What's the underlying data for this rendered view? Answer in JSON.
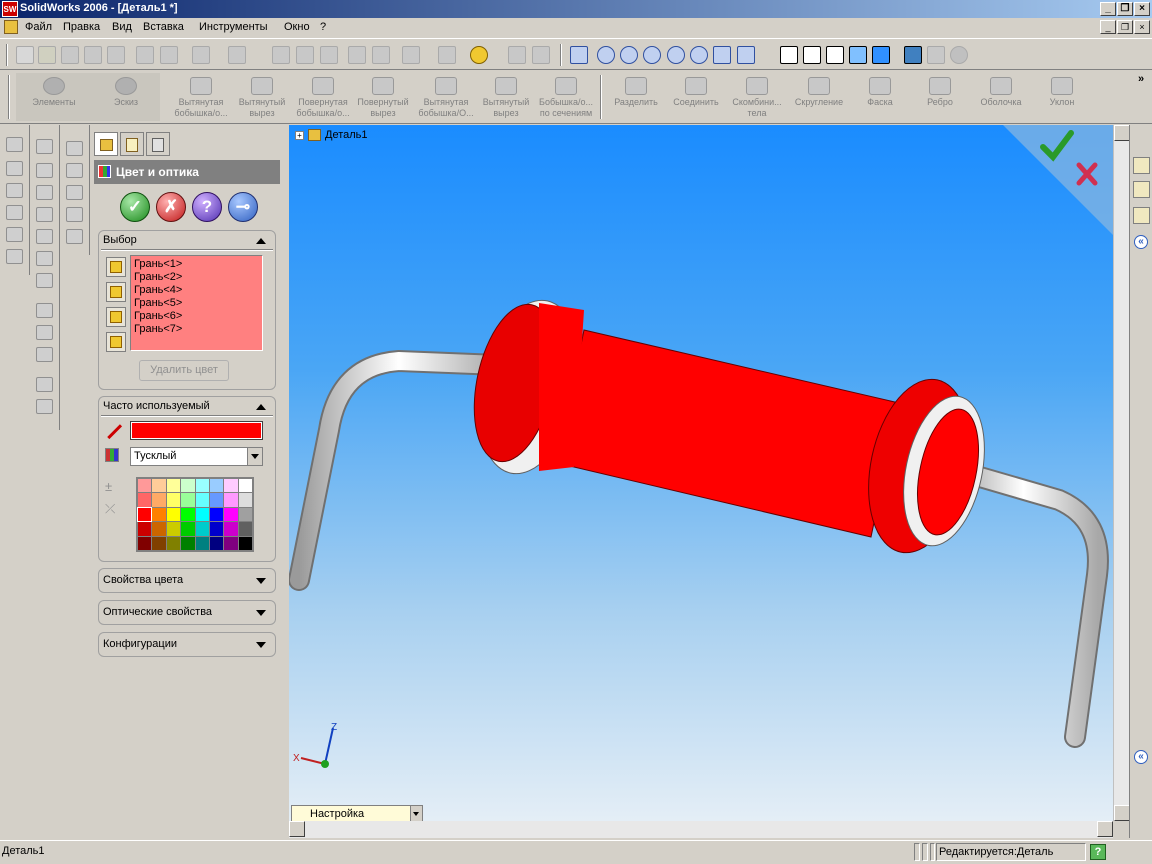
{
  "window": {
    "title": "SolidWorks 2006 - [Деталь1 *]",
    "logo_text": "SW"
  },
  "menu": {
    "items": [
      "Файл",
      "Правка",
      "Вид",
      "Вставка",
      "Инструменты",
      "Окно",
      "?"
    ]
  },
  "command_manager": {
    "items": [
      {
        "label": "Элементы",
        "icon": "features-icon"
      },
      {
        "label": "Эскиз",
        "icon": "sketch-icon"
      },
      {
        "label": "Вытянутая бобышка/о...",
        "icon": "extruded-boss-icon"
      },
      {
        "label": "Вытянутый вырез",
        "icon": "extruded-cut-icon"
      },
      {
        "label": "Повернутая бобышка/о...",
        "icon": "revolved-boss-icon"
      },
      {
        "label": "Повернутый вырез",
        "icon": "revolved-cut-icon"
      },
      {
        "label": "Вытянутая бобышка/О...",
        "icon": "swept-boss-icon"
      },
      {
        "label": "Вытянутый вырез",
        "icon": "swept-cut-icon"
      },
      {
        "label": "Бобышка/о... по сечениям",
        "icon": "lofted-boss-icon"
      },
      {
        "label": "Разделить",
        "icon": "split-icon"
      },
      {
        "label": "Соединить",
        "icon": "join-icon"
      },
      {
        "label": "Скомбини... тела",
        "icon": "combine-icon"
      },
      {
        "label": "Скругление",
        "icon": "fillet-icon"
      },
      {
        "label": "Фаска",
        "icon": "chamfer-icon"
      },
      {
        "label": "Ребро",
        "icon": "rib-icon"
      },
      {
        "label": "Оболочка",
        "icon": "shell-icon"
      },
      {
        "label": "Уклон",
        "icon": "draft-icon"
      }
    ],
    "more": "»"
  },
  "property_manager": {
    "title": "Цвет и оптика",
    "ok": "✓",
    "cancel": "✗",
    "help": "?",
    "pin": "⊸",
    "selection": {
      "title": "Выбор",
      "faces": [
        "Грань<1>",
        "Грань<2>",
        "Грань<4>",
        "Грань<5>",
        "Грань<6>",
        "Грань<7>"
      ],
      "remove_button": "Удалить цвет",
      "list_color": "#ff8080"
    },
    "favorite": {
      "title": "Часто используемый",
      "current_color": "#ff0000",
      "finish": "Тусклый",
      "palette": [
        "#ff9999",
        "#ffcc99",
        "#ffff99",
        "#ccffcc",
        "#99ffff",
        "#99ccff",
        "#ffccff",
        "#ffffff",
        "#ff6666",
        "#ffaa66",
        "#ffff66",
        "#99ff99",
        "#66ffff",
        "#6699ff",
        "#ff99ff",
        "#dddddd",
        "#ff0000",
        "#ff8000",
        "#ffff00",
        "#00ff00",
        "#00ffff",
        "#0000ff",
        "#ff00ff",
        "#a0a0a0",
        "#cc0000",
        "#cc6600",
        "#cccc00",
        "#00cc00",
        "#00cccc",
        "#0000cc",
        "#cc00cc",
        "#606060",
        "#800000",
        "#804000",
        "#808000",
        "#008000",
        "#008080",
        "#000080",
        "#800080",
        "#000000"
      ]
    },
    "collapsed_groups": [
      "Свойства цвета",
      "Оптические свойства",
      "Конфигурации"
    ]
  },
  "viewport": {
    "tree_root": "Деталь1",
    "config_tab": "Настройка",
    "axes": {
      "x": "X",
      "z": "Z"
    },
    "resistor_color": "#ff0000"
  },
  "status": {
    "left": "Деталь1",
    "editing": "Редактируется:Деталь",
    "help": "?"
  }
}
